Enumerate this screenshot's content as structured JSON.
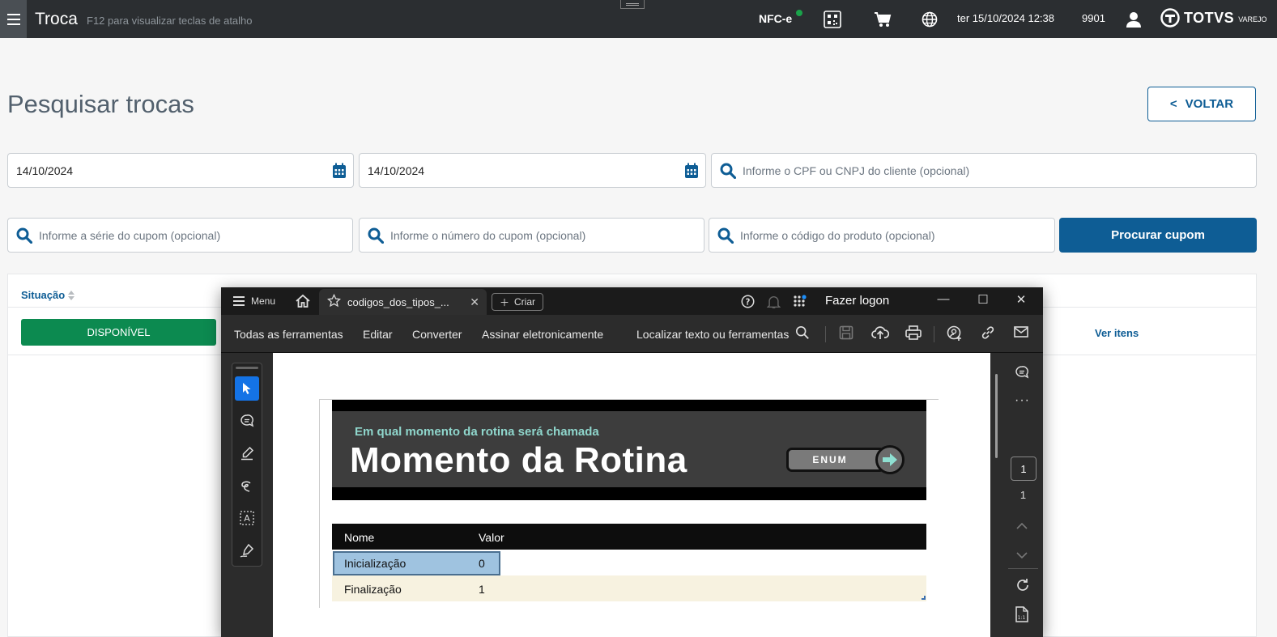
{
  "topbar": {
    "title": "Troca",
    "hint": "F12 para visualizar teclas de atalho",
    "nfce_label": "NFC-e",
    "datetime": "ter 15/10/2024 12:38",
    "store_code": "9901",
    "brand": "TOTVS",
    "brand_sub": "VAREJO",
    "icons": [
      "menu-icon",
      "qr-code-icon",
      "cart-icon",
      "globe-icon",
      "user-icon",
      "totvs-logo-icon"
    ]
  },
  "page": {
    "title": "Pesquisar trocas",
    "back_label": "VOLTAR",
    "back_prefix": "<"
  },
  "filters": {
    "date_start": "14/10/2024",
    "date_end": "14/10/2024",
    "customer_placeholder": "Informe o CPF ou CNPJ do cliente (opcional)",
    "serie_placeholder": "Informe a série do cupom (opcional)",
    "numero_placeholder": "Informe o número do cupom (opcional)",
    "produto_placeholder": "Informe o código do produto (opcional)",
    "search_button": "Procurar cupom"
  },
  "grid": {
    "column_situacao": "Situação",
    "rows": [
      {
        "status": "DISPONÍVEL",
        "action": "Ver itens"
      }
    ]
  },
  "viewer": {
    "menu_label": "Menu",
    "tab_title": "codigos_dos_tipos_...",
    "new_label": "Criar",
    "logon_label": "Fazer logon",
    "tools": {
      "all_tools": "Todas as ferramentas",
      "edit": "Editar",
      "convert": "Converter",
      "sign": "Assinar eletronicamente",
      "find": "Localizar texto ou ferramentas"
    },
    "page_current": "1",
    "page_total": "1",
    "document": {
      "banner_subtitle": "Em qual momento da rotina será chamada",
      "banner_title": "Momento da Rotina",
      "badge": "ENUM",
      "table_headers": [
        "Nome",
        "Valor"
      ],
      "table_rows": [
        [
          "Inicialização",
          "0"
        ],
        [
          "Finalização",
          "1"
        ]
      ]
    }
  },
  "colors": {
    "primary": "#0e5d95",
    "success": "#0c8a50",
    "topbar": "#2b2e31",
    "banner_subtitle": "#8fd6cc"
  }
}
